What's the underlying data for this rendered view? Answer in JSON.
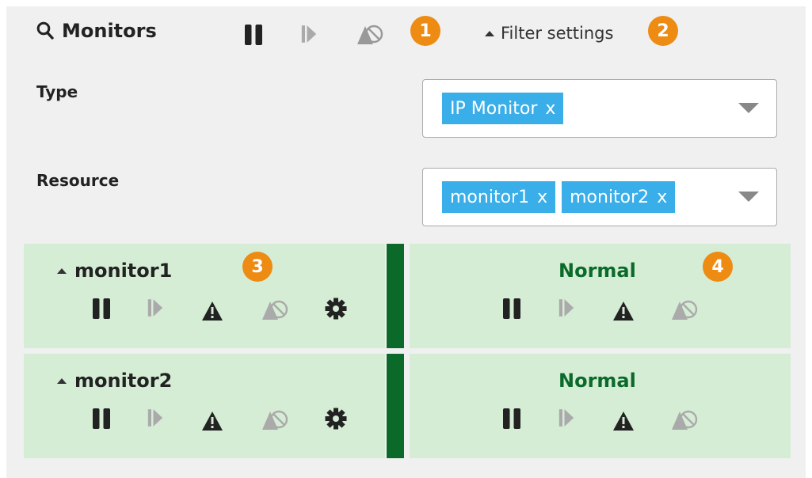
{
  "header": {
    "title": "Monitors",
    "filter_toggle_label": "Filter settings",
    "badges": [
      "1",
      "2"
    ]
  },
  "filters": {
    "type": {
      "label": "Type",
      "chips": [
        "IP Monitor"
      ]
    },
    "resource": {
      "label": "Resource",
      "chips": [
        "monitor1",
        "monitor2"
      ]
    },
    "chip_remove": "x"
  },
  "monitors": [
    {
      "name": "monitor1",
      "status": "Normal",
      "left_badge": "3",
      "right_badge": "4"
    },
    {
      "name": "monitor2",
      "status": "Normal"
    }
  ],
  "colors": {
    "badge": "#ed8b13",
    "chip": "#3aaee8",
    "row_bg": "#d5edd5",
    "status_normal": "#0b6a2a",
    "separator": "#0b6a2a"
  },
  "icons": {
    "search": "search-icon",
    "pause": "pause-icon",
    "resume": "resume-icon",
    "warning": "warning-icon",
    "suppress": "suppress-alert-icon",
    "settings": "gear-icon"
  }
}
